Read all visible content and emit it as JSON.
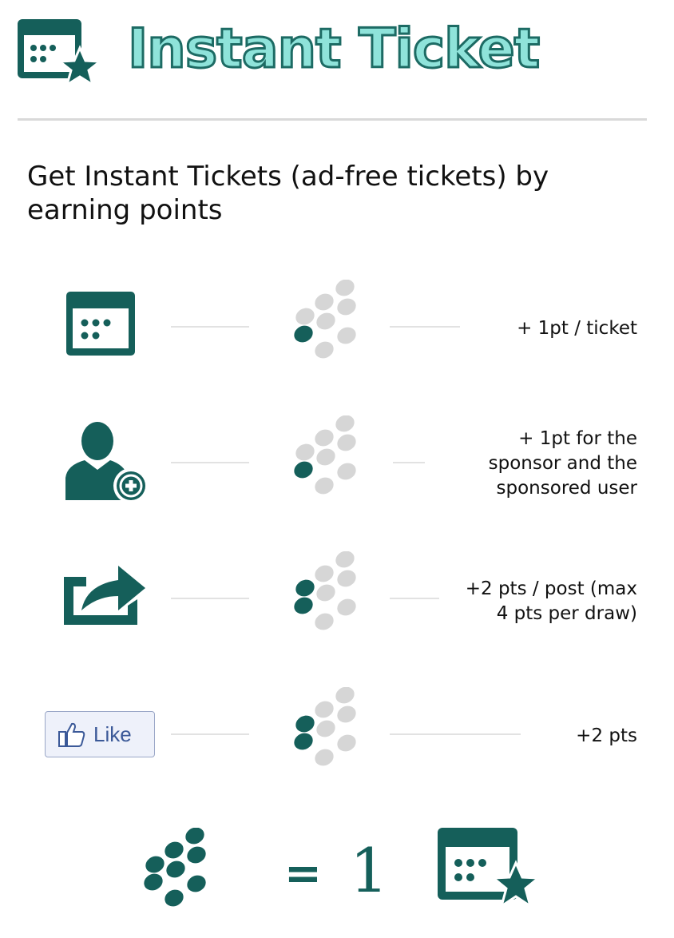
{
  "header": {
    "title": "Instant Ticket",
    "logo_icon": "calendar-star-icon"
  },
  "headline": "Get Instant Tickets (ad-free tickets) by earning points",
  "colors": {
    "teal": "#155f5a",
    "dot_grey": "#d6d6d6",
    "logo_fill": "#8fe3da",
    "facebook_blue": "#3b5998"
  },
  "rows": [
    {
      "icon": "calendar-icon",
      "filled_dots": 1,
      "lines": [
        "+ 1pt / ticket"
      ]
    },
    {
      "icon": "add-user-icon",
      "filled_dots": 1,
      "lines": [
        "+ 1pt for the",
        "sponsor and the",
        "sponsored user"
      ]
    },
    {
      "icon": "share-icon",
      "filled_dots": 2,
      "lines": [
        "+2 pts / post (max",
        "4 pts per draw)"
      ]
    },
    {
      "icon": "facebook-like-icon",
      "like_label": "Like",
      "filled_dots": 2,
      "lines": [
        "+2 pts"
      ]
    }
  ],
  "footer": {
    "equals": "=",
    "count": "1",
    "filled_dots": 8,
    "result_icon": "calendar-star-icon"
  }
}
